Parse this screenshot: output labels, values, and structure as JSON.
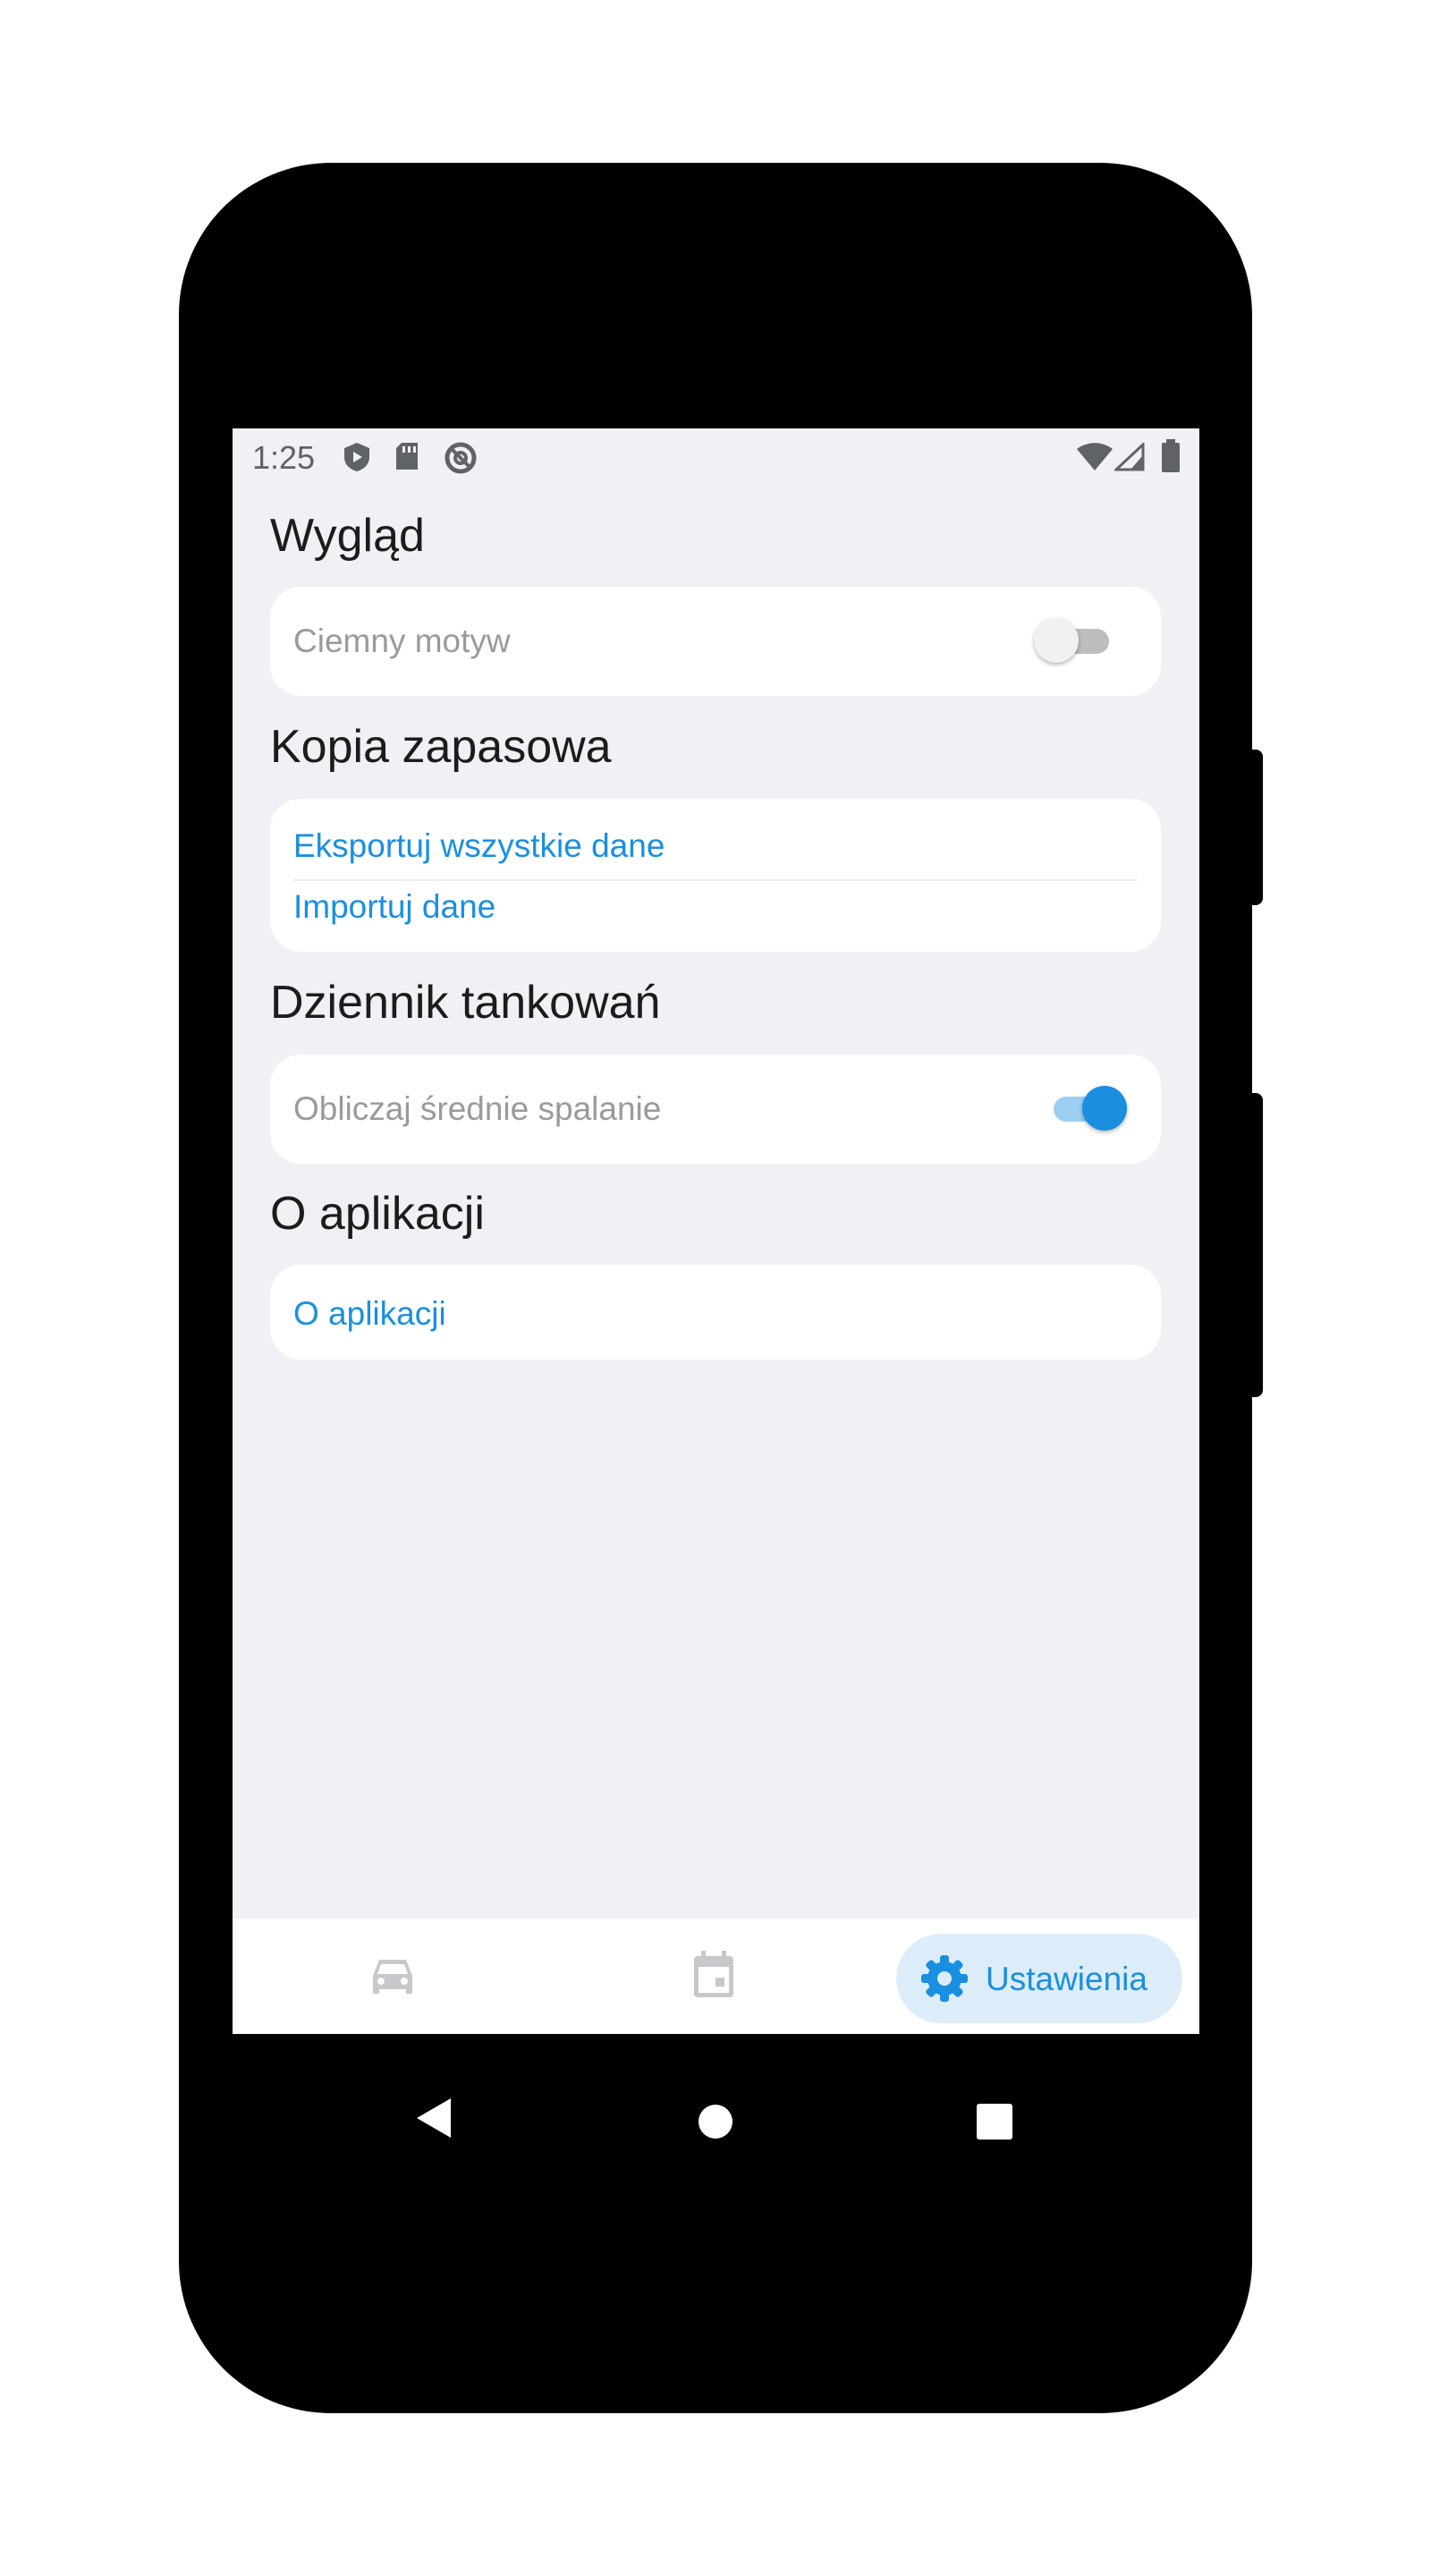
{
  "status_bar": {
    "time": "1:25"
  },
  "sections": {
    "appearance": {
      "title": "Wygląd",
      "dark_theme_label": "Ciemny motyw",
      "dark_theme_enabled": false
    },
    "backup": {
      "title": "Kopia zapasowa",
      "export_label": "Eksportuj wszystkie dane",
      "import_label": "Importuj dane"
    },
    "fuel_log": {
      "title": "Dziennik tankowań",
      "avg_consumption_label": "Obliczaj średnie spalanie",
      "avg_consumption_enabled": true
    },
    "about": {
      "title": "O aplikacji",
      "about_link": "O aplikacji"
    }
  },
  "bottom_nav": {
    "items": [
      {
        "icon": "car-icon",
        "label": ""
      },
      {
        "icon": "calendar-icon",
        "label": ""
      },
      {
        "icon": "gear-icon",
        "label": "Ustawienia",
        "active": true
      }
    ]
  },
  "colors": {
    "accent": "#1a8fe0",
    "background": "#f1f1f5",
    "active_pill": "#dcedf9"
  }
}
